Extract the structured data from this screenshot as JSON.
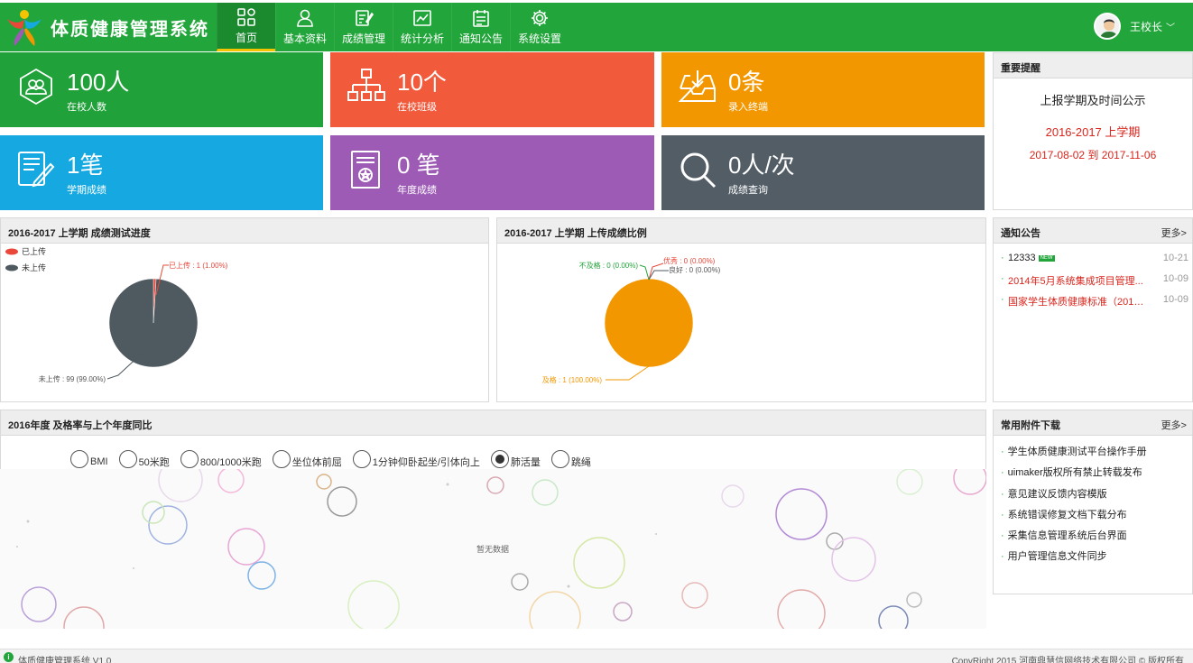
{
  "app": {
    "title": "体质健康管理系统"
  },
  "nav": [
    {
      "label": "首页",
      "icon": "grid-icon",
      "active": true
    },
    {
      "label": "基本资料",
      "icon": "user-icon",
      "active": false
    },
    {
      "label": "成绩管理",
      "icon": "edit-doc-icon",
      "active": false
    },
    {
      "label": "统计分析",
      "icon": "line-chart-icon",
      "active": false
    },
    {
      "label": "通知公告",
      "icon": "notice-board-icon",
      "active": false
    },
    {
      "label": "系统设置",
      "icon": "gear-icon",
      "active": false
    }
  ],
  "user": {
    "name": "王校长"
  },
  "tiles": [
    {
      "value": "100人",
      "label": "在校人数",
      "icon": "users-icon",
      "color": "#21a13a"
    },
    {
      "value": "10个",
      "label": "在校班级",
      "icon": "org-tree-icon",
      "color": "#f25a3c"
    },
    {
      "value": "0条",
      "label": "录入终端",
      "icon": "inbox-download-icon",
      "color": "#f39700"
    },
    {
      "value": "1笔",
      "label": "学期成绩",
      "icon": "edit-note-icon",
      "color": "#16a9e1"
    },
    {
      "value": "0 笔",
      "label": "年度成绩",
      "icon": "certificate-icon",
      "color": "#9d5bb6"
    },
    {
      "value": "0人/次",
      "label": "成绩查询",
      "icon": "search-icon",
      "color": "#525d66"
    }
  ],
  "reminder": {
    "title": "重要提醒",
    "heading": "上报学期及时间公示",
    "term": "2016-2017 上学期",
    "range": "2017-08-02 到 2017-11-06"
  },
  "progress_panel": {
    "title": "2016-2017 上学期 成绩测试进度",
    "legend": [
      "已上传",
      "未上传"
    ],
    "label_uploaded": "已上传 : 1 (1.00%)",
    "label_not_uploaded": "未上传 : 99 (99.00%)"
  },
  "ratio_panel": {
    "title": "2016-2017 上学期 上传成绩比例",
    "label_fail": "不及格 : 0 (0.00%)",
    "label_excellent": "优秀 : 0 (0.00%)",
    "label_good": "良好 : 0 (0.00%)",
    "label_pass": "及格 : 1 (100.00%)"
  },
  "chart_data": [
    {
      "type": "pie",
      "title": "2016-2017 上学期 成绩测试进度",
      "series": [
        {
          "name": "已上传",
          "value": 1,
          "percent": 1.0,
          "color": "#e8473a"
        },
        {
          "name": "未上传",
          "value": 99,
          "percent": 99.0,
          "color": "#4f5960"
        }
      ]
    },
    {
      "type": "pie",
      "title": "2016-2017 上学期 上传成绩比例",
      "series": [
        {
          "name": "优秀",
          "value": 0,
          "percent": 0.0,
          "color": "#e8473a"
        },
        {
          "name": "良好",
          "value": 0,
          "percent": 0.0,
          "color": "#4f5960"
        },
        {
          "name": "及格",
          "value": 1,
          "percent": 100.0,
          "color": "#f39700"
        },
        {
          "name": "不及格",
          "value": 0,
          "percent": 0.0,
          "color": "#22a53a"
        }
      ]
    }
  ],
  "notices": {
    "title": "通知公告",
    "more": "更多>",
    "items": [
      {
        "title": "12333",
        "date": "10-21",
        "new": true,
        "color": "#222"
      },
      {
        "title": "2014年5月系统集成项目管理...",
        "date": "10-09",
        "new": false,
        "color": "#d9251c"
      },
      {
        "title": "国家学生体质健康标准（2014...",
        "date": "10-09",
        "new": false,
        "color": "#d9251c"
      }
    ],
    "new_badge": "NEW"
  },
  "yoy_panel": {
    "title": "2016年度 及格率与上个年度同比",
    "options": [
      "BMI",
      "50米跑",
      "800/1000米跑",
      "坐位体前屈",
      "1分钟仰卧起坐/引体向上",
      "肺活量",
      "跳绳"
    ],
    "selected": "肺活量",
    "empty_text": "暂无数据"
  },
  "downloads": {
    "title": "常用附件下载",
    "more": "更多>",
    "items": [
      "学生体质健康测试平台操作手册",
      "uimaker版权所有禁止转载发布",
      "意见建议反馈内容模版",
      "系统错误修复文档下载分布",
      "采集信息管理系统后台界面",
      "用户管理信息文件同步"
    ]
  },
  "footer": {
    "left": "体质健康管理系统 V1.0",
    "right": "CopyRight 2015  河南鼎慧信网络技术有限公司 ©  版权所有"
  }
}
